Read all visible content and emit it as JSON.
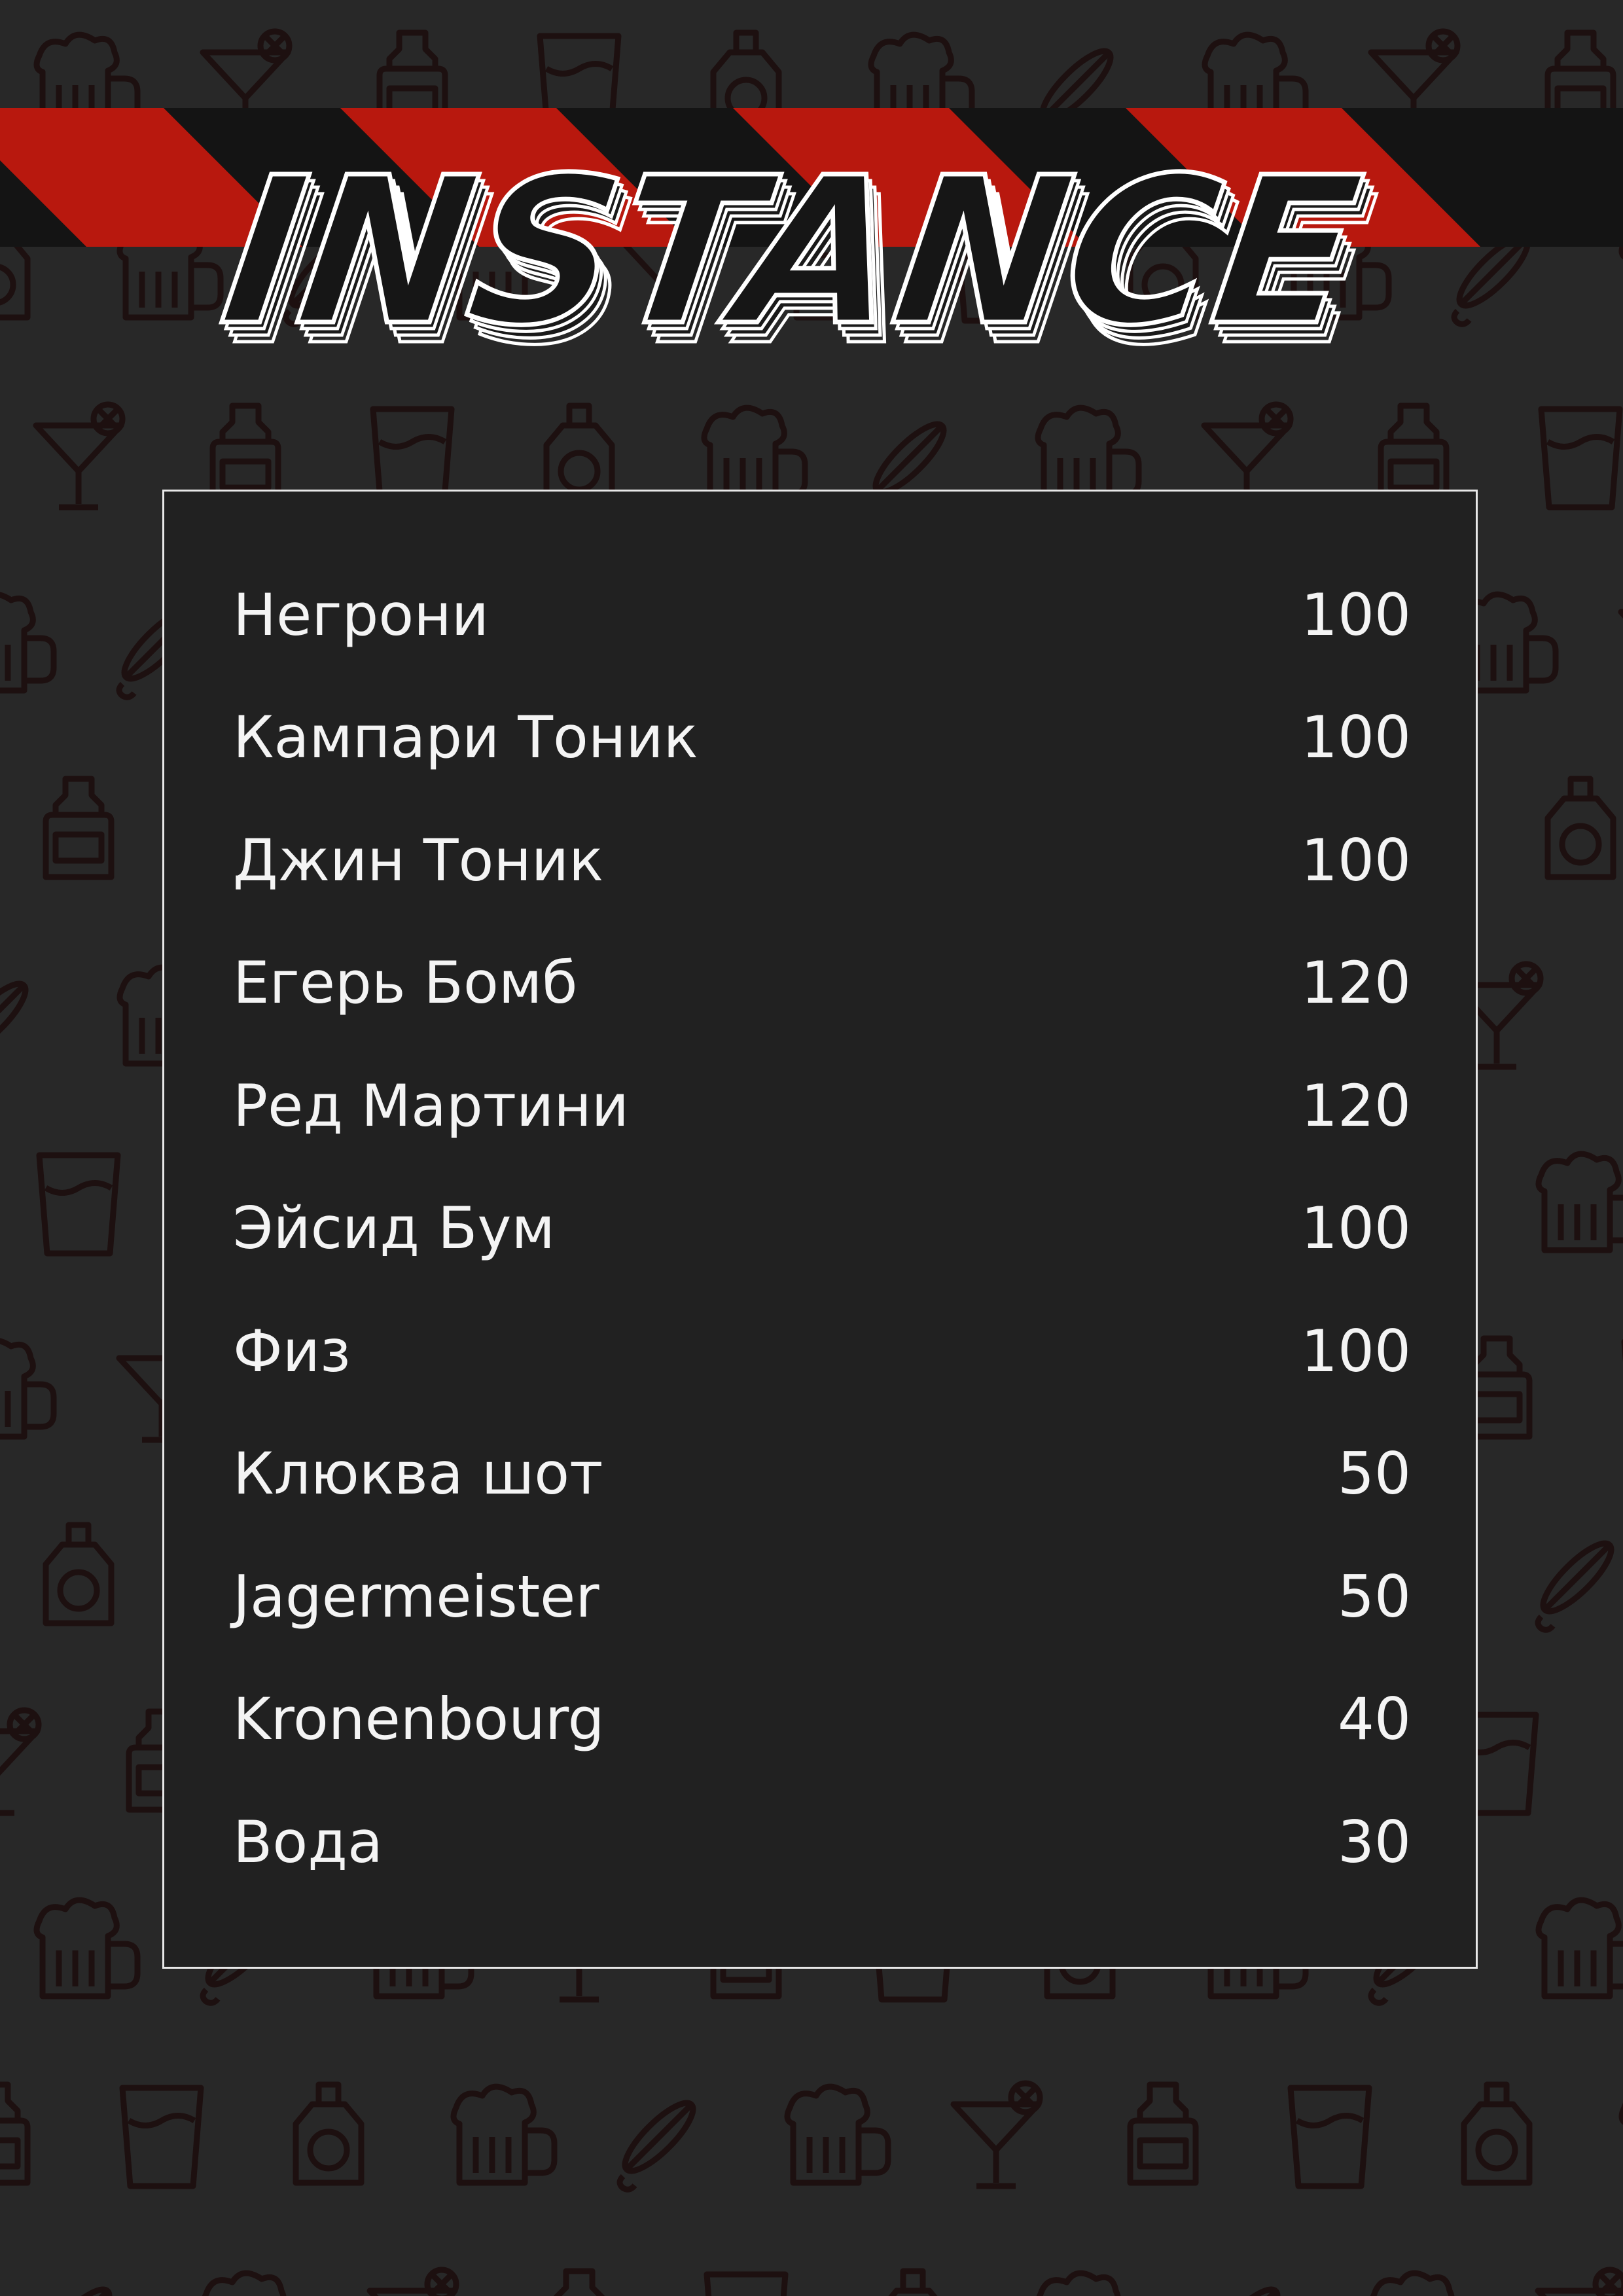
{
  "brand": {
    "title": "INSTANCE",
    "colors": {
      "accent": "#b8180e",
      "background": "#282828",
      "card": "#212121",
      "text": "#f4f4f4"
    }
  },
  "background_icons": [
    "beer-mug-icon",
    "cocktail-glass-icon",
    "bottle-icon",
    "tumbler-glass-icon",
    "whiskey-bottle-icon",
    "corkscrew-icon",
    "ice-glass-icon"
  ],
  "menu": {
    "items": [
      {
        "name": "Негрони",
        "price": "100"
      },
      {
        "name": "Кампари Тоник",
        "price": "100"
      },
      {
        "name": "Джин Тоник",
        "price": "100"
      },
      {
        "name": "Егерь Бомб",
        "price": "120"
      },
      {
        "name": "Ред Мартини",
        "price": "120"
      },
      {
        "name": "Эйсид Бум",
        "price": "100"
      },
      {
        "name": "Физ",
        "price": "100"
      },
      {
        "name": "Клюква шот",
        "price": "50"
      },
      {
        "name": "Jagermeister",
        "price": "50"
      },
      {
        "name": "Kronenbourg",
        "price": "40"
      },
      {
        "name": "Вода",
        "price": "30"
      }
    ]
  }
}
